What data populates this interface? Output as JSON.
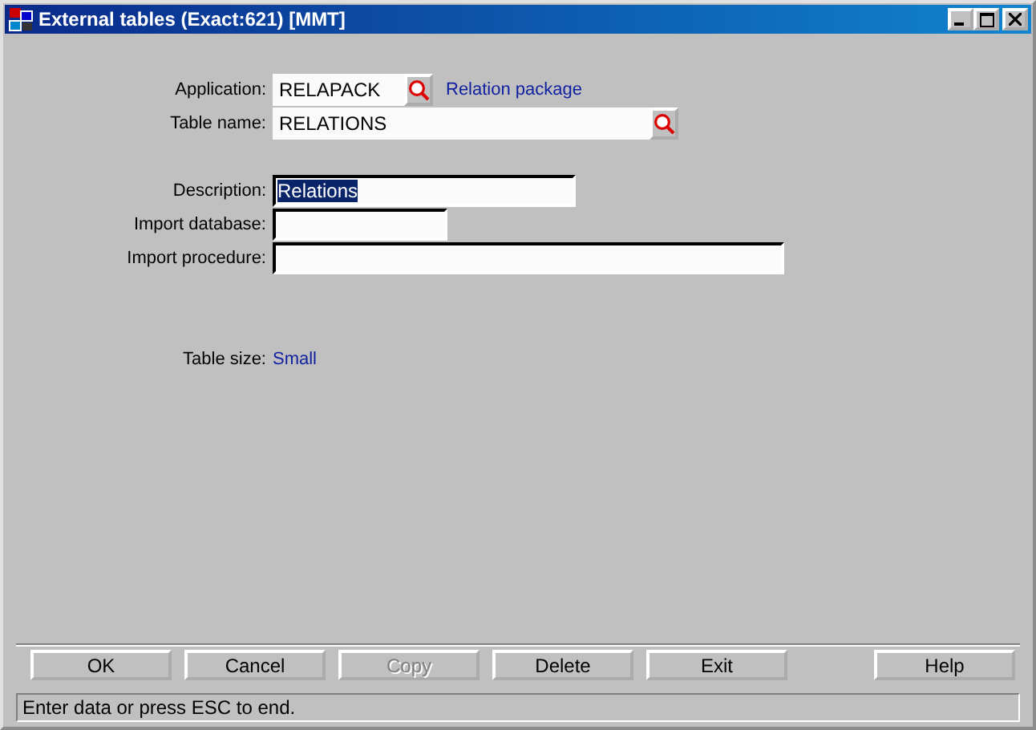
{
  "window": {
    "title": "External tables (Exact:621) [MMT]"
  },
  "fields": [
    {
      "kind": "lookup",
      "label": "Application:",
      "value": "RELAPACK",
      "info": "Relation package"
    },
    {
      "kind": "lookup",
      "label": "Table name:",
      "value": "RELATIONS"
    },
    {
      "kind": "gap"
    },
    {
      "kind": "text",
      "label": "Description:",
      "value": "Relations",
      "selected": true
    },
    {
      "kind": "text",
      "label": "Import database:"
    },
    {
      "kind": "text",
      "label": "Import procedure:"
    },
    {
      "kind": "gap"
    },
    {
      "kind": "gap"
    },
    {
      "kind": "info",
      "label": "Table size:",
      "info": "Small"
    }
  ],
  "buttons": [
    {
      "label": "OK",
      "disabled": false
    },
    {
      "label": "Cancel",
      "disabled": false
    },
    {
      "label": "Copy",
      "disabled": true
    },
    {
      "label": "Delete",
      "disabled": false
    },
    {
      "label": "Exit",
      "disabled": false
    },
    {
      "label": "Help",
      "disabled": false
    }
  ],
  "status_bar": "Enter data or press ESC to end."
}
